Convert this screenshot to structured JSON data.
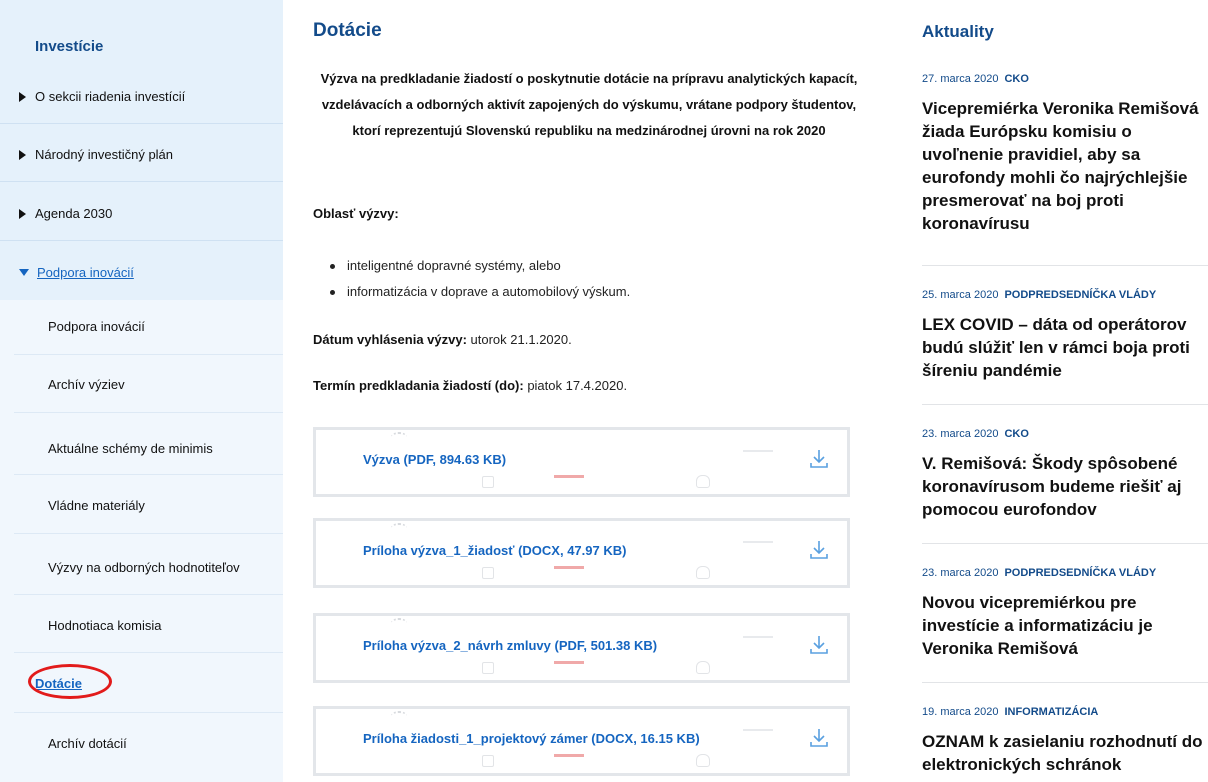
{
  "sidebar": {
    "title": "Investície",
    "top_items": [
      {
        "label": "O sekcii riadenia investícií"
      },
      {
        "label": "Národný investičný plán"
      },
      {
        "label": "Agenda 2030"
      },
      {
        "label": "Podpora inovácií"
      }
    ],
    "sub_items": [
      {
        "label": "Podpora inovácií"
      },
      {
        "label": "Archív výziev"
      },
      {
        "label": "Aktuálne schémy de minimis"
      },
      {
        "label": "Vládne materiály"
      },
      {
        "label": "Výzvy na odborných hodnotiteľov"
      },
      {
        "label": "Hodnotiaca komisia"
      },
      {
        "label": "Dotácie"
      },
      {
        "label": "Archív dotácií"
      }
    ]
  },
  "main": {
    "title": "Dotácie",
    "call_title": "Výzva na predkladanie žiadostí o poskytnutie dotácie na prípravu analytických kapacít, vzdelávacích a odborných aktivít zapojených do výskumu, vrátane podpory študentov, ktorí reprezentujú Slovenskú republiku na medzinárodnej úrovni na rok 2020",
    "area_label": "Oblasť výzvy:",
    "areas": [
      "inteligentné dopravné systémy, alebo",
      "informatizácia v doprave a automobilový výskum."
    ],
    "announce_label": "Dátum vyhlásenia výzvy:",
    "announce_value": "utorok 21.1.2020.",
    "deadline_label": "Termín predkladania žiadostí (do):",
    "deadline_value": "piatok 17.4.2020.",
    "documents": [
      {
        "label": "Výzva (PDF, 894.63 KB)"
      },
      {
        "label": "Príloha výzva_1_žiadosť (DOCX, 47.97 KB)"
      },
      {
        "label": "Príloha výzva_2_návrh zmluvy (PDF, 501.38 KB)"
      },
      {
        "label": "Príloha žiadosti_1_projektový zámer (DOCX, 16.15 KB)"
      }
    ]
  },
  "news": {
    "title": "Aktuality",
    "items": [
      {
        "date": "27. marca 2020",
        "tag": "CKO",
        "headline": "Vicepremiérka Veronika Remišová žiada Európsku komisiu o uvoľnenie pravidiel, aby sa eurofondy mohli čo najrýchlejšie presmerovať na boj proti koronavírusu"
      },
      {
        "date": "25. marca 2020",
        "tag": "PODPREDSEDNÍČKA VLÁDY",
        "headline": "LEX COVID – dáta od operátorov budú slúžiť len v rámci boja proti šíreniu pandémie"
      },
      {
        "date": "23. marca 2020",
        "tag": "CKO",
        "headline": "V. Remišová: Škody spôsobené koronavírusom budeme riešiť aj pomocou eurofondov"
      },
      {
        "date": "23. marca 2020",
        "tag": "PODPREDSEDNÍČKA VLÁDY",
        "headline": "Novou vicepremiérkou pre investície a informatizáciu je Veronika Remišová"
      },
      {
        "date": "19. marca 2020",
        "tag": "INFORMATIZÁCIA",
        "headline": "OZNAM k zasielaniu rozhodnutí do elektronických schránok"
      }
    ]
  }
}
